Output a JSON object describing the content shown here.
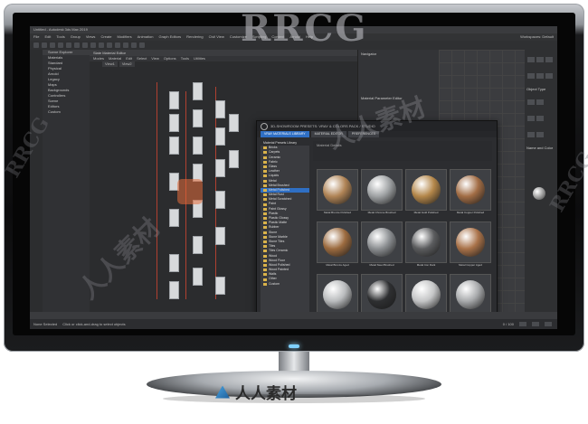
{
  "window": {
    "title": "Untitled - Autodesk 3ds Max 2019",
    "menus": [
      "File",
      "Edit",
      "Tools",
      "Group",
      "Views",
      "Create",
      "Modifiers",
      "Animation",
      "Graph Editors",
      "Rendering",
      "Civil View",
      "Customize",
      "Scripting",
      "Content",
      "Arnold",
      "Help"
    ],
    "workspace_label": "Workspaces: Default"
  },
  "scene_explorer": {
    "title": "Scene Explorer",
    "items": [
      "Materials",
      "Standard",
      "Physical",
      "Arnold",
      "Legacy",
      "Maps",
      "Backgrounds",
      "Controllers",
      "Scene",
      "Editors",
      "Custom"
    ]
  },
  "slate": {
    "title": "Slate Material Editor",
    "menus": [
      "Modes",
      "Material",
      "Edit",
      "Select",
      "View",
      "Options",
      "Tools",
      "Utilities"
    ],
    "tabs": [
      "View1",
      "View2"
    ],
    "view_label": "View1"
  },
  "params_panel": {
    "title": "Navigator",
    "subtitle": "Material Parameter Editor"
  },
  "command_panel": {
    "title": "Object Type",
    "section": "Name and Color"
  },
  "material_library": {
    "title": "3D-SHOWROOM PRESETS: VRAY & COLORS PACK / STUDIO",
    "tabs": [
      "VRAY MATERIALS LIBRARY",
      "MATERIAL EDITOR",
      "PREFERENCES"
    ],
    "active_tab": "VRAY MATERIALS LIBRARY",
    "tree_header": "Material Presets Library",
    "tree_items": [
      "Bricks",
      "Carpets",
      "Ceramic",
      "Fabric",
      "Glass",
      "Leather",
      "Liquids",
      "Metal",
      "Metal Brushed",
      "Metal Polished",
      "Metal Rust",
      "Metal Scratched",
      "Paint",
      "Paint Glossy",
      "Plastic",
      "Plastic Glossy",
      "Plastic Matte",
      "Rubber",
      "Stone",
      "Stone Marble",
      "Stone Tiles",
      "Tiles",
      "Tiles Ceramic",
      "Wood",
      "Wood Floor",
      "Wood Polished",
      "Wood Painted",
      "Walls",
      "Other",
      "Custom"
    ],
    "selected_item": "Metal Polished",
    "details_label": "Material Details",
    "materials": [
      {
        "name": "Metal Bronze Polished",
        "color": "#b08456"
      },
      {
        "name": "Metal Chrome Brushed",
        "color": "#9fa2a4"
      },
      {
        "name": "Metal Gold Polished",
        "color": "#b4874a"
      },
      {
        "name": "Metal Copper Polished",
        "color": "#a26d45"
      },
      {
        "name": "Metal Bronze Aged",
        "color": "#9c6b3f"
      },
      {
        "name": "Metal Steel Brushed",
        "color": "#8c8f92"
      },
      {
        "name": "Metal Iron Dark",
        "color": "#5b5c5e"
      },
      {
        "name": "Metal Copper Aged",
        "color": "#a97249"
      },
      {
        "name": "Metal Silver Polished",
        "color": "#b9bbbd"
      },
      {
        "name": "Metal Black Chrome",
        "color": "#2e2f31"
      },
      {
        "name": "Metal Aluminum Satin",
        "color": "#c4c5c6"
      },
      {
        "name": "Metal Nickel Polished",
        "color": "#a8aaac"
      }
    ]
  },
  "status": {
    "selection": "None Selected",
    "prompt": "Click or click-and-drag to select objects",
    "frame": "0 / 100"
  },
  "watermarks": {
    "main": "RRCG",
    "side_left": "RRCG",
    "side_right": "RRCG",
    "cn1": "人人素材",
    "cn2": "人人素材",
    "bottom": "人人素材"
  },
  "colors": {
    "accent": "#2f6fc4",
    "led": "#7fd0ff"
  }
}
